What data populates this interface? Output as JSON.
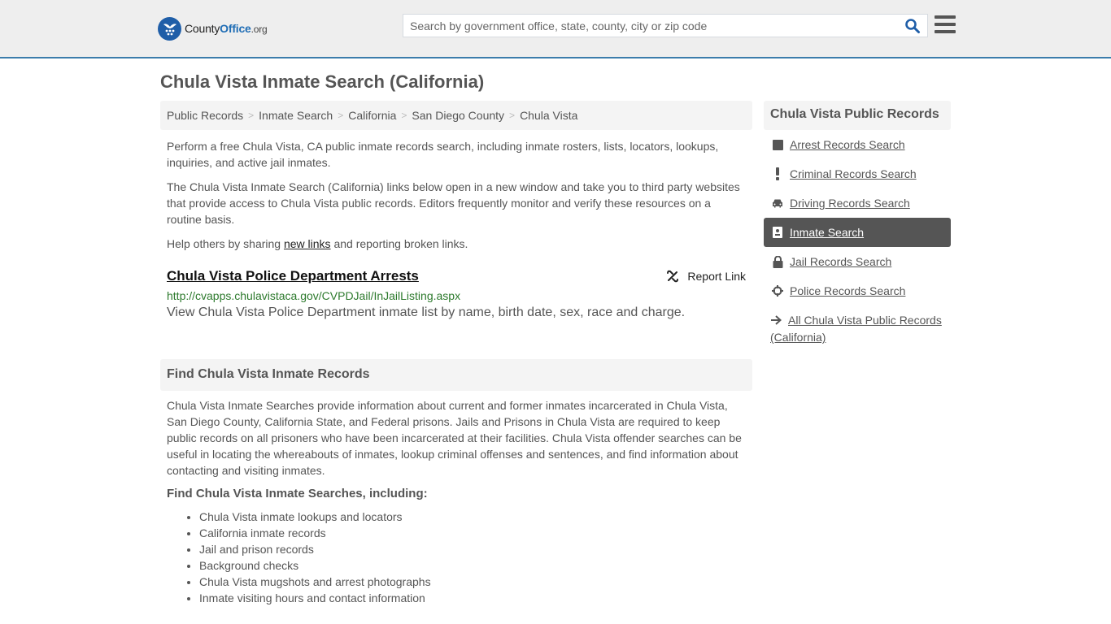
{
  "header": {
    "logo": {
      "county": "County",
      "office": "Office",
      "org": ".org"
    },
    "search_placeholder": "Search by government office, state, county, city or zip code",
    "search_value": ""
  },
  "colors": {
    "header_bg": "#eeeeee",
    "header_border": "#3b7cab",
    "brand_blue": "#1f6db5",
    "url_green": "#2d7a2d",
    "active_sidebar_bg": "#555555"
  },
  "page_title": "Chula Vista Inmate Search (California)",
  "breadcrumb": [
    {
      "label": "Public Records"
    },
    {
      "label": "Inmate Search"
    },
    {
      "label": "California"
    },
    {
      "label": "San Diego County"
    },
    {
      "label": "Chula Vista"
    }
  ],
  "intro": {
    "p1": "Perform a free Chula Vista, CA public inmate records search, including inmate rosters, lists, locators, lookups, inquiries, and active jail inmates.",
    "p2": "The Chula Vista Inmate Search (California) links below open in a new window and take you to third party websites that provide access to Chula Vista public records. Editors frequently monitor and verify these resources on a routine basis.",
    "p3_before": "Help others by sharing ",
    "p3_link": "new links",
    "p3_after": " and reporting broken links."
  },
  "resource": {
    "title": "Chula Vista Police Department Arrests",
    "report_label": "Report Link",
    "url": "http://cvapps.chulavistaca.gov/CVPDJail/InJailListing.aspx",
    "description": "View Chula Vista Police Department inmate list by name, birth date, sex, race and charge."
  },
  "find_section": {
    "heading": "Find Chula Vista Inmate Records",
    "body": "Chula Vista Inmate Searches provide information about current and former inmates incarcerated in Chula Vista, San Diego County, California State, and Federal prisons. Jails and Prisons in Chula Vista are required to keep public records on all prisoners who have been incarcerated at their facilities. Chula Vista offender searches can be useful in locating the whereabouts of inmates, lookup criminal offenses and sentences, and find information about contacting and visiting inmates.",
    "subheading": "Find Chula Vista Inmate Searches, including:",
    "items": [
      "Chula Vista inmate lookups and locators",
      "California inmate records",
      "Jail and prison records",
      "Background checks",
      "Chula Vista mugshots and arrest photographs",
      "Inmate visiting hours and contact information"
    ]
  },
  "sidebar": {
    "heading": "Chula Vista Public Records",
    "items": [
      {
        "label": "Arrest Records Search",
        "icon": "square-icon",
        "active": false
      },
      {
        "label": "Criminal Records Search",
        "icon": "exclamation-icon",
        "active": false
      },
      {
        "label": "Driving Records Search",
        "icon": "car-icon",
        "active": false
      },
      {
        "label": "Inmate Search",
        "icon": "id-badge-icon",
        "active": true
      },
      {
        "label": "Jail Records Search",
        "icon": "lock-icon",
        "active": false
      },
      {
        "label": "Police Records Search",
        "icon": "crosshairs-icon",
        "active": false
      },
      {
        "label": "All Chula Vista Public Records (California)",
        "icon": "arrow-right-icon",
        "active": false
      }
    ]
  }
}
